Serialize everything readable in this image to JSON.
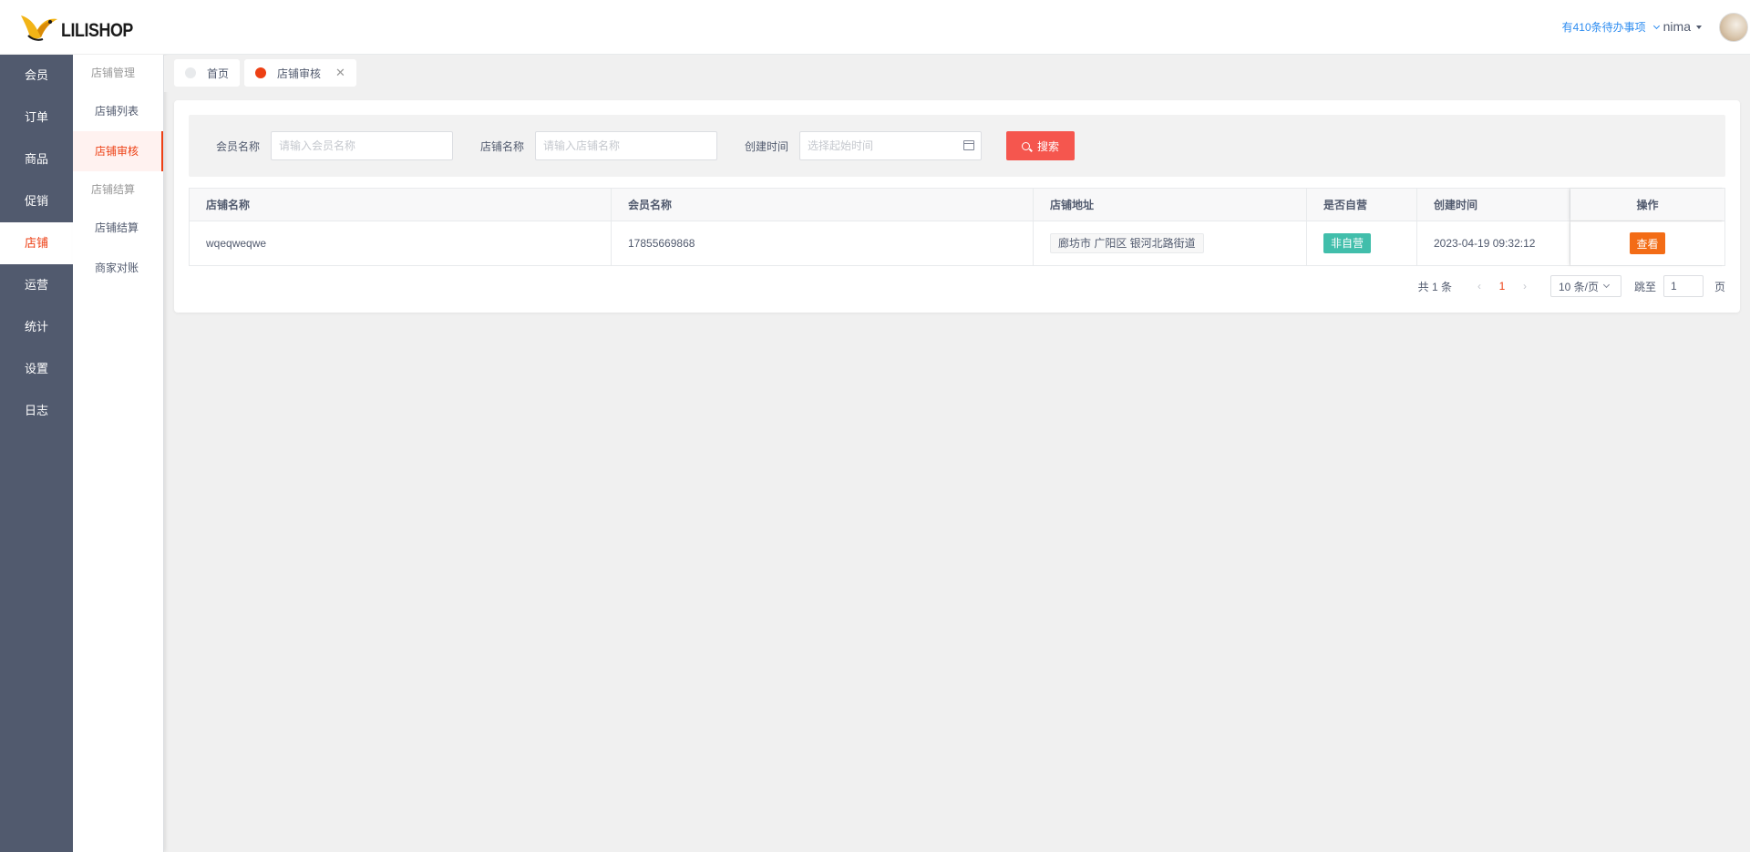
{
  "brand": {
    "name": "LILISHOP"
  },
  "main_menu": [
    {
      "label": "会员",
      "active": false
    },
    {
      "label": "订单",
      "active": false
    },
    {
      "label": "商品",
      "active": false
    },
    {
      "label": "促销",
      "active": false
    },
    {
      "label": "店铺",
      "active": true
    },
    {
      "label": "运营",
      "active": false
    },
    {
      "label": "统计",
      "active": false
    },
    {
      "label": "设置",
      "active": false
    },
    {
      "label": "日志",
      "active": false
    }
  ],
  "sub_menu": {
    "group_1_title": "店铺管理",
    "group_1_items": [
      "店铺列表",
      "店铺审核"
    ],
    "group_2_title": "店铺结算",
    "group_2_items": [
      "店铺结算",
      "商家对账"
    ],
    "active_item": "店铺审核"
  },
  "header": {
    "todo_text": "有410条待办事项",
    "user_name": "nima"
  },
  "tabs": [
    {
      "label": "首页",
      "active": false
    },
    {
      "label": "店铺审核",
      "active": true
    }
  ],
  "search": {
    "member_label": "会员名称",
    "member_placeholder": "请输入会员名称",
    "store_label": "店铺名称",
    "store_placeholder": "请输入店铺名称",
    "date_label": "创建时间",
    "date_placeholder": "选择起始时间",
    "button_label": "搜索"
  },
  "table": {
    "columns": [
      "店铺名称",
      "会员名称",
      "店铺地址",
      "是否自营",
      "创建时间",
      "操作"
    ],
    "rows": [
      {
        "store_name": "wqeqweqwe",
        "member_name": "17855669868",
        "address": "廊坊市 广阳区 银河北路街道",
        "self_operated": "非自营",
        "created_at": "2023-04-19 09:32:12",
        "action": "查看"
      }
    ]
  },
  "pagination": {
    "total_text": "共 1 条",
    "current_page": "1",
    "page_size": "10 条/页",
    "jump_label": "跳至",
    "jump_value": "1",
    "jump_suffix": "页"
  },
  "colors": {
    "sidebar_bg": "#515a6e",
    "accent_red": "#ed4014",
    "search_button": "#f5564e",
    "view_button": "#f36c16",
    "status_tag": "#2db7a3",
    "link_blue": "#2d8cf0"
  }
}
